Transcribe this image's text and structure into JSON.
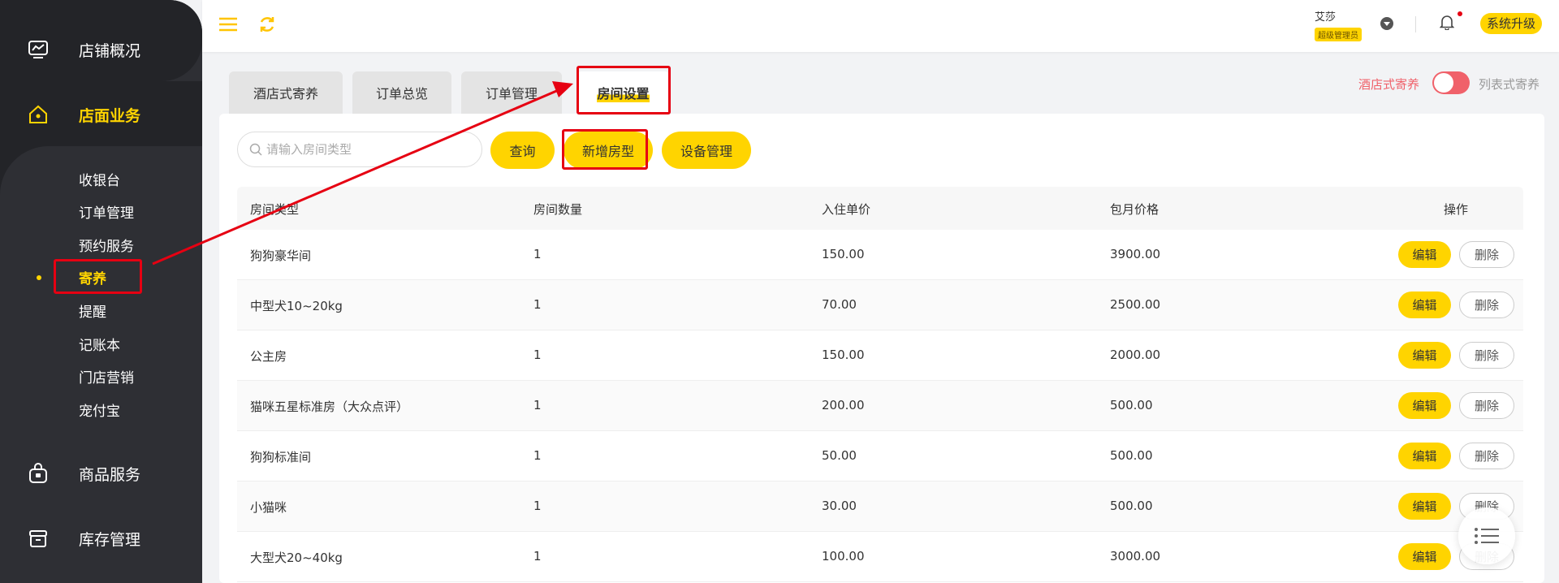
{
  "sidebar": {
    "main_items": [
      {
        "label": "店铺概况",
        "icon": "monitor-icon"
      },
      {
        "label": "店面业务",
        "icon": "home-icon"
      },
      {
        "label": "商品服务",
        "icon": "bag-icon"
      },
      {
        "label": "库存管理",
        "icon": "box-icon"
      }
    ],
    "sub_items": [
      {
        "label": "收银台"
      },
      {
        "label": "订单管理"
      },
      {
        "label": "预约服务"
      },
      {
        "label": "寄养"
      },
      {
        "label": "提醒"
      },
      {
        "label": "记账本"
      },
      {
        "label": "门店营销"
      },
      {
        "label": "宠付宝"
      }
    ],
    "active_sub": "寄养"
  },
  "header": {
    "user_name": "艾莎",
    "user_role": "超级管理员",
    "upgrade_label": "系统升级",
    "icons": [
      "menu-icon",
      "refresh-icon",
      "bell-icon"
    ]
  },
  "tabs": [
    {
      "label": "酒店式寄养"
    },
    {
      "label": "订单总览"
    },
    {
      "label": "订单管理"
    },
    {
      "label": "房间设置",
      "active": true
    }
  ],
  "mode_toggle": {
    "left_label": "酒店式寄养",
    "right_label": "列表式寄养"
  },
  "toolbar": {
    "search_placeholder": "请输入房间类型",
    "query_label": "查询",
    "add_label": "新增房型",
    "device_label": "设备管理"
  },
  "table": {
    "columns": [
      "房间类型",
      "房间数量",
      "入住单价",
      "包月价格",
      "操作"
    ],
    "edit_label": "编辑",
    "delete_label": "删除",
    "rows": [
      {
        "type": "狗狗豪华间",
        "count": "1",
        "price": "150.00",
        "monthly": "3900.00"
      },
      {
        "type": "中型犬10~20kg",
        "count": "1",
        "price": "70.00",
        "monthly": "2500.00"
      },
      {
        "type": "公主房",
        "count": "1",
        "price": "150.00",
        "monthly": "2000.00"
      },
      {
        "type": "猫咪五星标准房（大众点评）",
        "count": "1",
        "price": "200.00",
        "monthly": "500.00"
      },
      {
        "type": "狗狗标准间",
        "count": "1",
        "price": "50.00",
        "monthly": "500.00"
      },
      {
        "type": "小猫咪",
        "count": "1",
        "price": "30.00",
        "monthly": "500.00"
      },
      {
        "type": "大型犬20~40kg",
        "count": "1",
        "price": "100.00",
        "monthly": "3000.00"
      }
    ]
  },
  "colors": {
    "accent": "#ffd400",
    "sidebar": "#2e2f34",
    "annotation": "#e60012",
    "toggle": "#f0616a"
  }
}
